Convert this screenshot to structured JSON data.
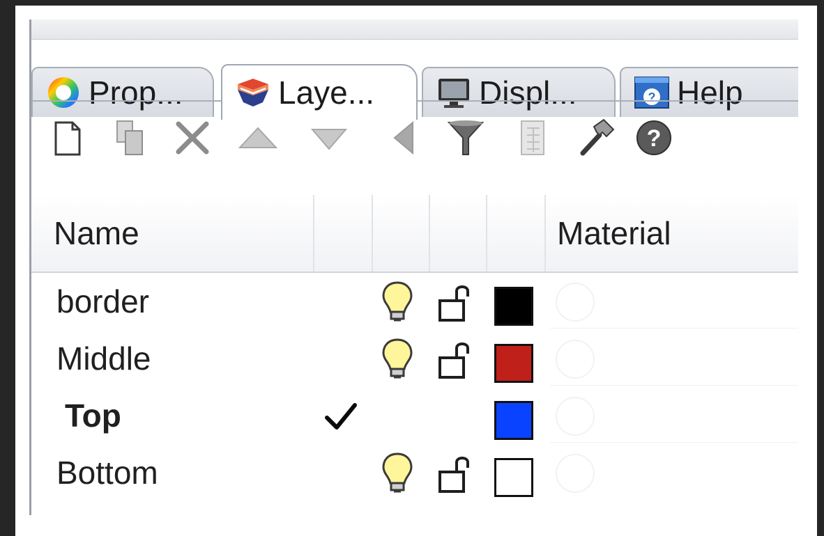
{
  "tabs": [
    {
      "label": "Prop...",
      "icon": "properties-color-wheel-icon",
      "active": false
    },
    {
      "label": "Laye...",
      "icon": "layers-icon",
      "active": true
    },
    {
      "label": "Displ...",
      "icon": "display-monitor-icon",
      "active": false
    },
    {
      "label": "Help",
      "icon": "help-icon",
      "active": false
    }
  ],
  "toolbar": [
    "new-layer-icon",
    "new-sublayer-icon",
    "delete-icon",
    "move-up-icon",
    "move-down-icon",
    "move-out-icon",
    "filter-icon",
    "layer-states-icon",
    "tools-hammer-icon",
    "help-question-icon"
  ],
  "columns": {
    "name": "Name",
    "material": "Material"
  },
  "layers": [
    {
      "name": "border",
      "current": false,
      "on": true,
      "locked": false,
      "color": "#000000"
    },
    {
      "name": "Middle",
      "current": false,
      "on": true,
      "locked": false,
      "color": "#c0201a"
    },
    {
      "name": "Top",
      "current": true,
      "on": null,
      "locked": null,
      "color": "#0a43ff"
    },
    {
      "name": "Bottom",
      "current": false,
      "on": true,
      "locked": false,
      "color": "#ffffff"
    }
  ]
}
